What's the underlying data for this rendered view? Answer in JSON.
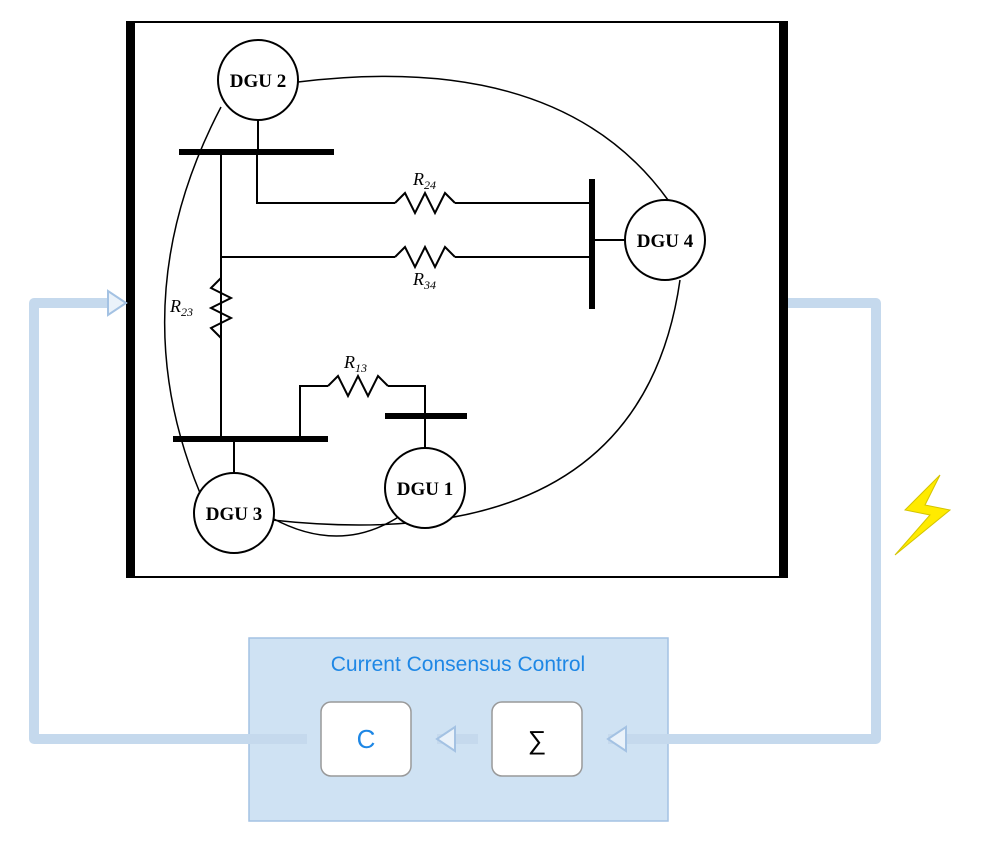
{
  "nodes": {
    "dgu1": "DGU 1",
    "dgu2": "DGU 2",
    "dgu3": "DGU 3",
    "dgu4": "DGU 4"
  },
  "resistors": {
    "r24": {
      "prefix": "R",
      "sub": "24"
    },
    "r34": {
      "prefix": "R",
      "sub": "34"
    },
    "r23": {
      "prefix": "R",
      "sub": "23"
    },
    "r13": {
      "prefix": "R",
      "sub": "13"
    }
  },
  "control": {
    "title": "Current Consensus Control",
    "block_c": "C",
    "block_sigma": "∑"
  }
}
